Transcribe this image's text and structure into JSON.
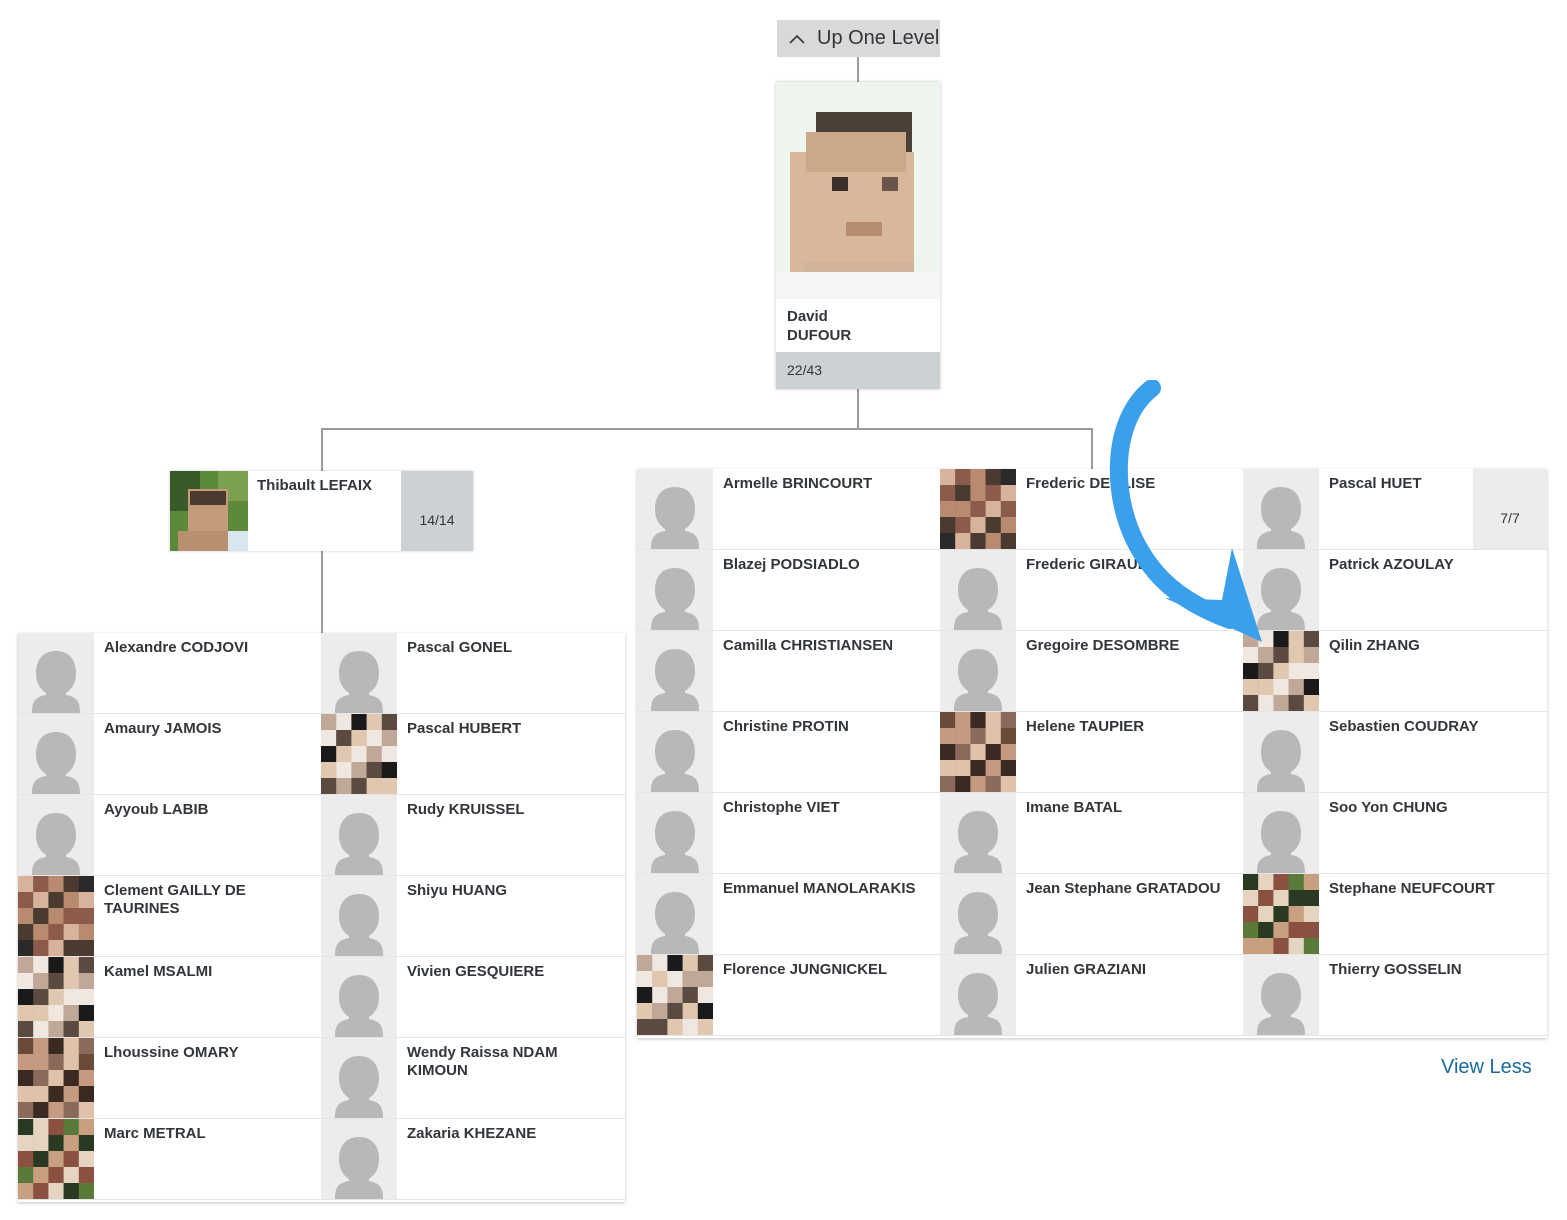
{
  "nav": {
    "up_label": "Up One Level"
  },
  "top": {
    "first": "David",
    "last": "DUFOUR",
    "count": "22/43"
  },
  "manager": {
    "name": "Thibault LEFAIX",
    "count": "14/14"
  },
  "left_reports": [
    {
      "name": "Alexandre CODJOVI",
      "photo": "placeholder"
    },
    {
      "name": "Pascal GONEL",
      "photo": "placeholder"
    },
    {
      "name": "Amaury JAMOIS",
      "photo": "placeholder"
    },
    {
      "name": "Pascal HUBERT",
      "photo": "photo"
    },
    {
      "name": "Ayyoub LABIB",
      "photo": "placeholder"
    },
    {
      "name": "Rudy KRUISSEL",
      "photo": "placeholder"
    },
    {
      "name": "Clement GAILLY DE TAURINES",
      "photo": "photo"
    },
    {
      "name": "Shiyu HUANG",
      "photo": "placeholder"
    },
    {
      "name": "Kamel MSALMI",
      "photo": "photo"
    },
    {
      "name": "Vivien GESQUIERE",
      "photo": "placeholder"
    },
    {
      "name": "Lhoussine OMARY",
      "photo": "photo"
    },
    {
      "name": "Wendy Raissa NDAM KIMOUN",
      "photo": "placeholder"
    },
    {
      "name": "Marc METRAL",
      "photo": "photo"
    },
    {
      "name": "Zakaria KHEZANE",
      "photo": "placeholder"
    }
  ],
  "right_reports": [
    {
      "name": "Armelle BRINCOURT",
      "photo": "placeholder"
    },
    {
      "name": "Frederic DEGLISE",
      "photo": "photo"
    },
    {
      "name": "Pascal HUET",
      "photo": "placeholder",
      "count": "7/7"
    },
    {
      "name": "Blazej PODSIADLO",
      "photo": "placeholder"
    },
    {
      "name": "Frederic GIRAUD",
      "photo": "placeholder"
    },
    {
      "name": "Patrick AZOULAY",
      "photo": "placeholder"
    },
    {
      "name": "Camilla CHRISTIANSEN",
      "photo": "placeholder"
    },
    {
      "name": "Gregoire DESOMBRE",
      "photo": "placeholder"
    },
    {
      "name": "Qilin ZHANG",
      "photo": "photo"
    },
    {
      "name": "Christine PROTIN",
      "photo": "placeholder"
    },
    {
      "name": "Helene TAUPIER",
      "photo": "photo"
    },
    {
      "name": "Sebastien COUDRAY",
      "photo": "placeholder"
    },
    {
      "name": "Christophe VIET",
      "photo": "placeholder"
    },
    {
      "name": "Imane BATAL",
      "photo": "placeholder"
    },
    {
      "name": "Soo Yon CHUNG",
      "photo": "placeholder"
    },
    {
      "name": "Emmanuel MANOLARAKIS",
      "photo": "placeholder"
    },
    {
      "name": "Jean Stephane GRATADOU",
      "photo": "placeholder"
    },
    {
      "name": "Stephane NEUFCOURT",
      "photo": "photo"
    },
    {
      "name": "Florence JUNGNICKEL",
      "photo": "photo"
    },
    {
      "name": "Julien GRAZIANI",
      "photo": "placeholder"
    },
    {
      "name": "Thierry GOSSELIN",
      "photo": "placeholder"
    }
  ],
  "footer": {
    "view_less": "View Less"
  },
  "colors": {
    "annotation_arrow": "#3aa0ec",
    "link": "#1a6a9a",
    "count_bg": "#ccd1d4"
  }
}
